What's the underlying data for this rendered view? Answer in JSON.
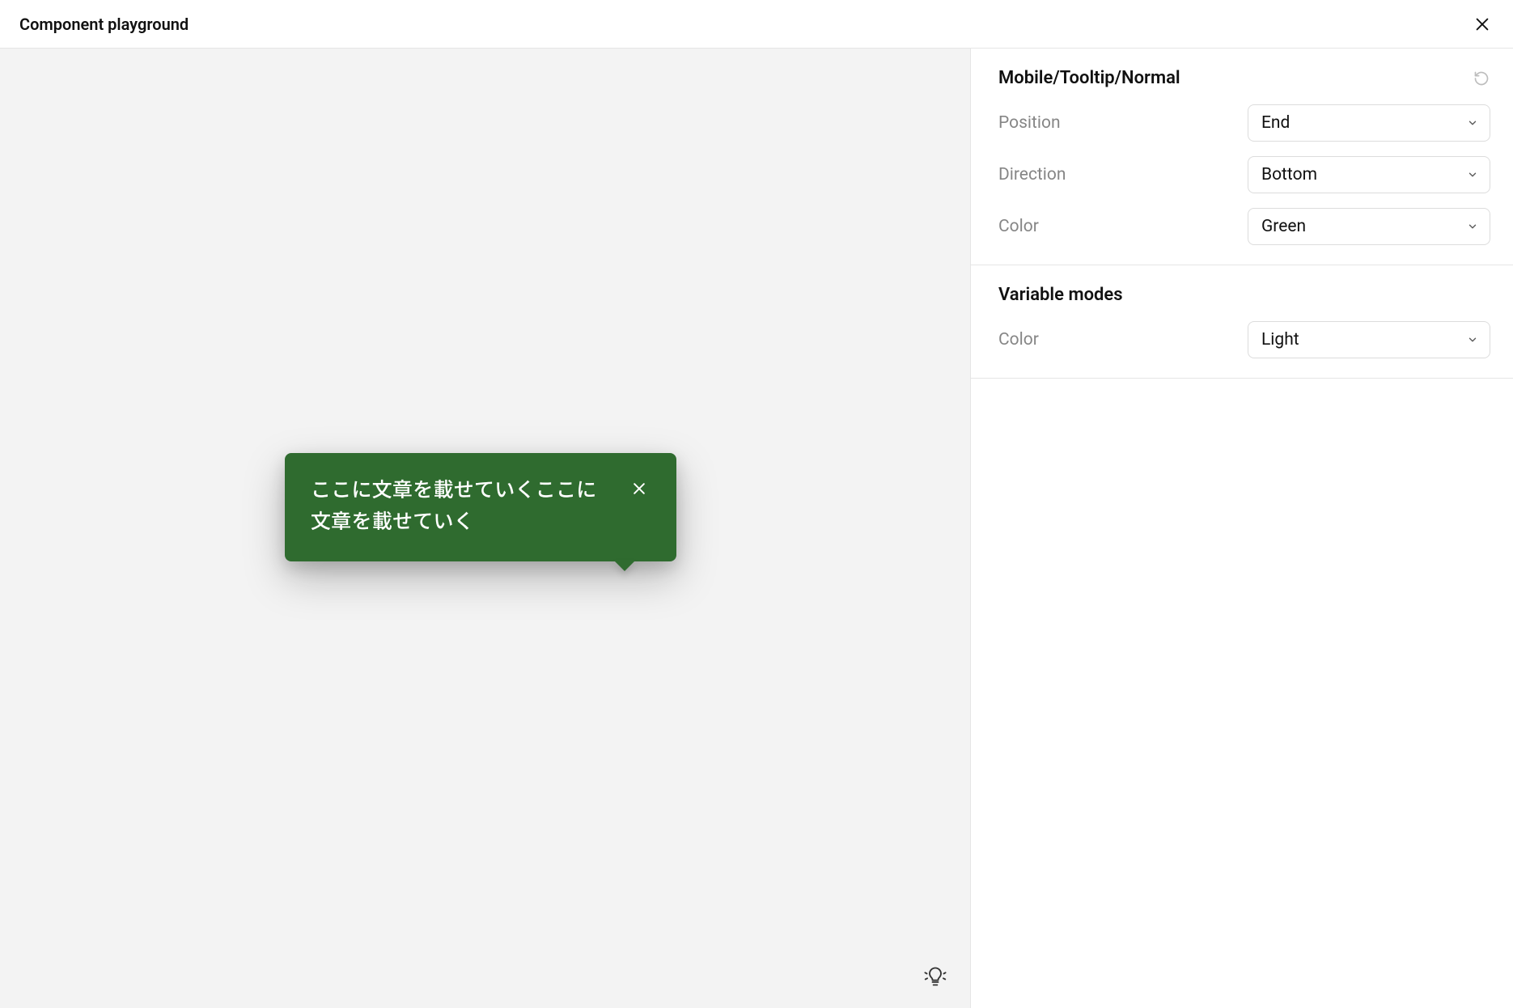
{
  "header": {
    "title": "Component playground"
  },
  "preview": {
    "tooltip_text": "ここに文章を載せていくここに文章を載せていく"
  },
  "panel": {
    "component_path": "Mobile/Tooltip/Normal",
    "props": [
      {
        "label": "Position",
        "value": "End"
      },
      {
        "label": "Direction",
        "value": "Bottom"
      },
      {
        "label": "Color",
        "value": "Green"
      }
    ],
    "modes_title": "Variable modes",
    "modes": [
      {
        "label": "Color",
        "value": "Light"
      }
    ]
  }
}
